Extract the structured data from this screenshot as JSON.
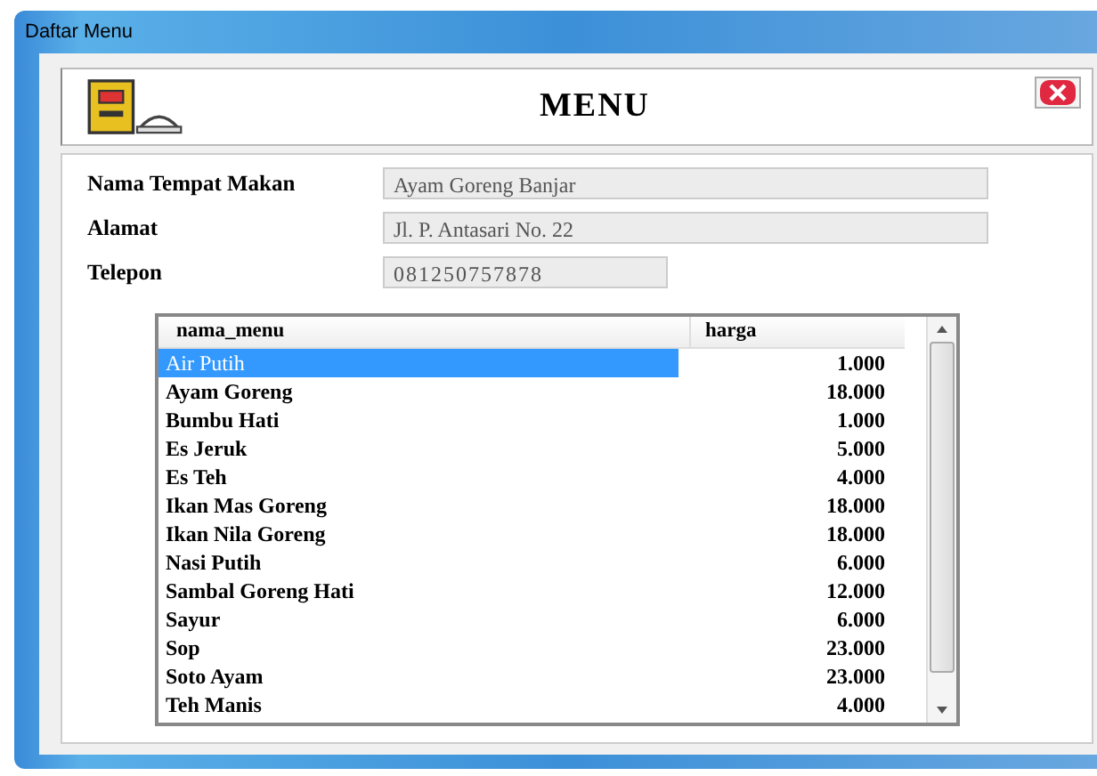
{
  "window": {
    "title": "Daftar Menu"
  },
  "header": {
    "title": "MENU"
  },
  "form": [
    {
      "label": "Nama Tempat Makan",
      "value": "Ayam Goreng Banjar",
      "kind": "wide"
    },
    {
      "label": "Alamat",
      "value": "Jl. P. Antasari No. 22",
      "kind": "wide"
    },
    {
      "label": "Telepon",
      "value": "081250757878",
      "kind": "short"
    }
  ],
  "table": {
    "columns": [
      "nama_menu",
      "harga"
    ],
    "rows": [
      {
        "cells": [
          "Air Putih",
          "1.000"
        ],
        "selected": true
      },
      {
        "cells": [
          "Ayam Goreng",
          "18.000"
        ],
        "selected": false
      },
      {
        "cells": [
          "Bumbu Hati",
          "1.000"
        ],
        "selected": false
      },
      {
        "cells": [
          "Es Jeruk",
          "5.000"
        ],
        "selected": false
      },
      {
        "cells": [
          "Es Teh",
          "4.000"
        ],
        "selected": false
      },
      {
        "cells": [
          "Ikan Mas Goreng",
          "18.000"
        ],
        "selected": false
      },
      {
        "cells": [
          "Ikan Nila Goreng",
          "18.000"
        ],
        "selected": false
      },
      {
        "cells": [
          "Nasi Putih",
          "6.000"
        ],
        "selected": false
      },
      {
        "cells": [
          "Sambal Goreng Hati",
          "12.000"
        ],
        "selected": false
      },
      {
        "cells": [
          "Sayur",
          "6.000"
        ],
        "selected": false
      },
      {
        "cells": [
          "Sop",
          "23.000"
        ],
        "selected": false
      },
      {
        "cells": [
          "Soto Ayam",
          "23.000"
        ],
        "selected": false
      },
      {
        "cells": [
          "Teh Manis",
          "4.000"
        ],
        "selected": false
      }
    ]
  }
}
